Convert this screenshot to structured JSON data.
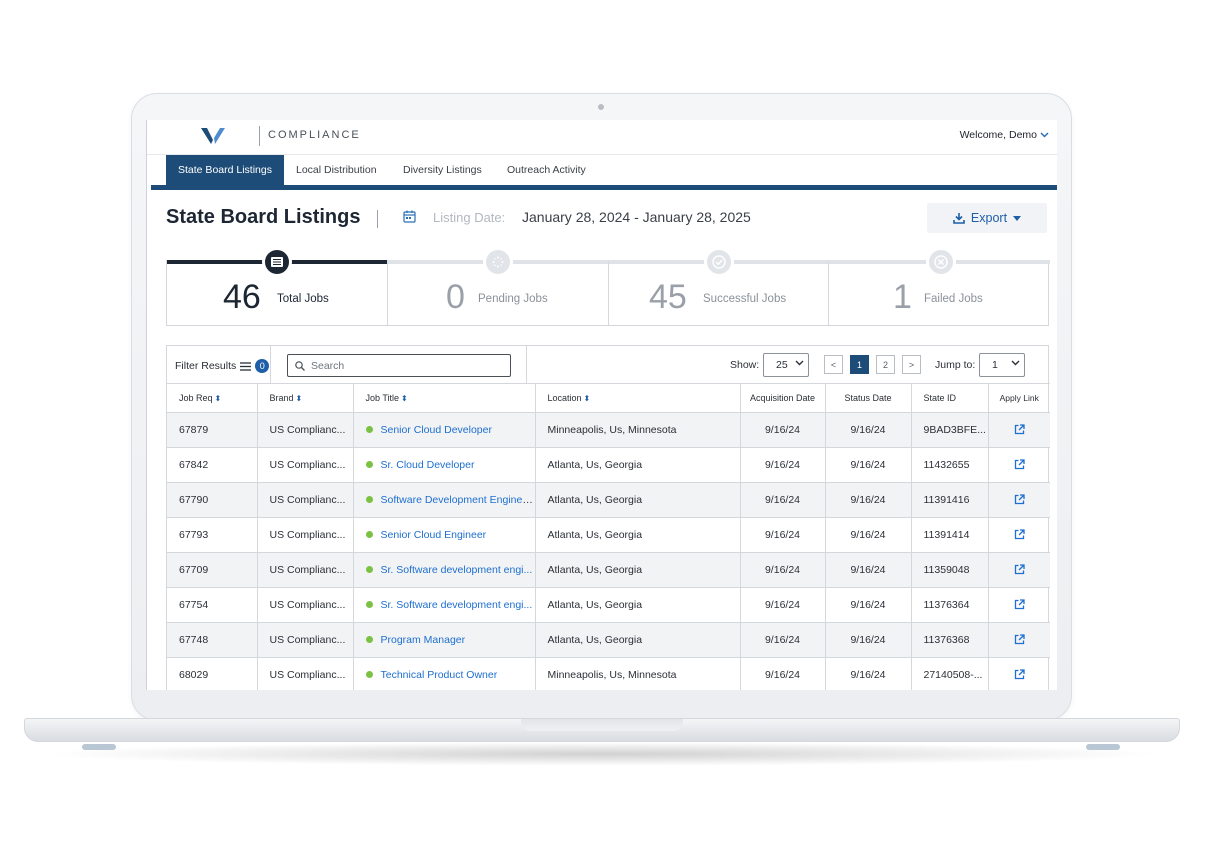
{
  "header": {
    "brand": "COMPLIANCE",
    "welcome": "Welcome, Demo"
  },
  "tabs": [
    {
      "label": "State Board Listings"
    },
    {
      "label": "Local Distribution"
    },
    {
      "label": "Diversity Listings"
    },
    {
      "label": "Outreach Activity"
    }
  ],
  "page": {
    "title": "State Board Listings",
    "date_label": "Listing Date:",
    "date_value": "January 28, 2024 - January 28, 2025",
    "export_label": "Export"
  },
  "stats": [
    {
      "value": "46",
      "label": "Total Jobs"
    },
    {
      "value": "0",
      "label": "Pending Jobs"
    },
    {
      "value": "45",
      "label": "Successful Jobs"
    },
    {
      "value": "1",
      "label": "Failed Jobs"
    }
  ],
  "toolbar": {
    "filter_label": "Filter Results",
    "filter_count": "0",
    "search_placeholder": "Search",
    "show_label": "Show:",
    "show_value": "25",
    "prev": "<",
    "pages": [
      "1",
      "2"
    ],
    "next": ">",
    "jump_label": "Jump to:",
    "jump_value": "1"
  },
  "table": {
    "columns": [
      "Job Req",
      "Brand",
      "Job Title",
      "Location",
      "Acquisition Date",
      "Status Date",
      "State ID",
      "Apply Link"
    ],
    "rows": [
      {
        "req": "67879",
        "brand": "US Complianc...",
        "title": "Senior Cloud Developer",
        "location": "Minneapolis, Us, Minnesota",
        "acq": "9/16/24",
        "status": "9/16/24",
        "state_id": "9BAD3BFE..."
      },
      {
        "req": "67842",
        "brand": "US Complianc...",
        "title": "Sr. Cloud Developer",
        "location": "Atlanta, Us, Georgia",
        "acq": "9/16/24",
        "status": "9/16/24",
        "state_id": "11432655"
      },
      {
        "req": "67790",
        "brand": "US Complianc...",
        "title": "Software Development Enginee...",
        "location": "Atlanta, Us, Georgia",
        "acq": "9/16/24",
        "status": "9/16/24",
        "state_id": "11391416"
      },
      {
        "req": "67793",
        "brand": "US Complianc...",
        "title": "Senior Cloud Engineer",
        "location": "Atlanta, Us, Georgia",
        "acq": "9/16/24",
        "status": "9/16/24",
        "state_id": "11391414"
      },
      {
        "req": "67709",
        "brand": "US Complianc...",
        "title": "Sr. Software development engi...",
        "location": "Atlanta, Us, Georgia",
        "acq": "9/16/24",
        "status": "9/16/24",
        "state_id": "11359048"
      },
      {
        "req": "67754",
        "brand": "US Complianc...",
        "title": "Sr. Software development engi...",
        "location": "Atlanta, Us, Georgia",
        "acq": "9/16/24",
        "status": "9/16/24",
        "state_id": "11376364"
      },
      {
        "req": "67748",
        "brand": "US Complianc...",
        "title": "Program Manager",
        "location": "Atlanta, Us, Georgia",
        "acq": "9/16/24",
        "status": "9/16/24",
        "state_id": "11376368"
      },
      {
        "req": "68029",
        "brand": "US Complianc...",
        "title": "Technical Product Owner",
        "location": "Minneapolis, Us, Minnesota",
        "acq": "9/16/24",
        "status": "9/16/24",
        "state_id": "27140508-..."
      }
    ]
  },
  "colors": {
    "primary": "#1e4c78",
    "link": "#1e6fd0",
    "status_dot": "#7bc144"
  }
}
